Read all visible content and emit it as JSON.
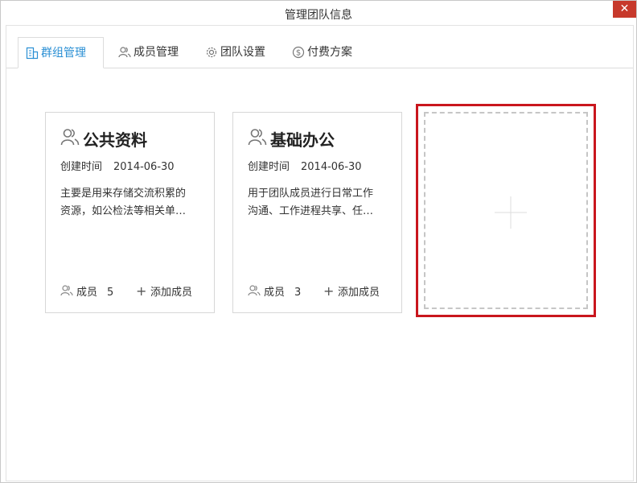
{
  "window": {
    "title": "管理团队信息",
    "close_glyph": "✕"
  },
  "tabs": [
    {
      "label": "群组管理",
      "icon": "building-icon",
      "active": true
    },
    {
      "label": "成员管理",
      "icon": "people-icon",
      "active": false
    },
    {
      "label": "团队设置",
      "icon": "gear-icon",
      "active": false
    },
    {
      "label": "付费方案",
      "icon": "dollar-circle-icon",
      "active": false
    }
  ],
  "groups": [
    {
      "name": "公共资料",
      "created_label": "创建时间",
      "created_date": "2014-06-30",
      "description_lines": [
        "主要是用来存储交流积累的",
        "资源，如公检法等相关单…"
      ],
      "members_label": "成员",
      "members_count": "5",
      "add_member_label": "添加成员"
    },
    {
      "name": "基础办公",
      "created_label": "创建时间",
      "created_date": "2014-06-30",
      "description_lines": [
        "用于团队成员进行日常工作",
        "沟通、工作进程共享、任…"
      ],
      "members_label": "成员",
      "members_count": "3",
      "add_member_label": "添加成员"
    }
  ],
  "new_group": {
    "icon": "plus-icon"
  },
  "colors": {
    "accent": "#2a8fd4",
    "close": "#c7392b",
    "highlight": "#c9161d"
  }
}
